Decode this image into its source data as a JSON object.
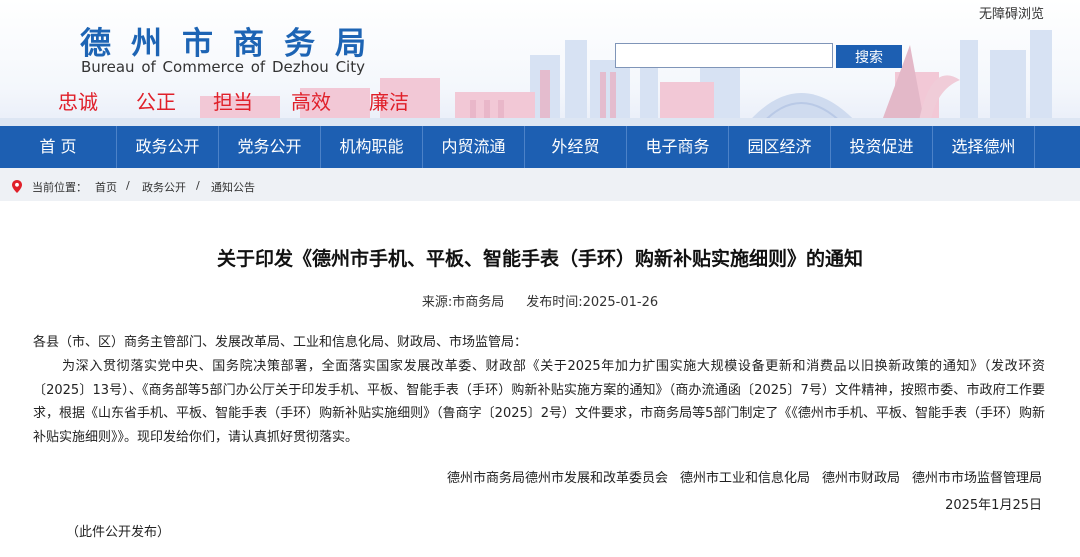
{
  "header": {
    "accessibility_link": "无障碍浏览",
    "site_title_cn": "德州市商务局",
    "site_title_en": "Bureau of Commerce of Dezhou City",
    "values": [
      "忠诚",
      "公正",
      "担当",
      "高效",
      "廉洁"
    ],
    "search": {
      "placeholder": "",
      "button_label": "搜索"
    }
  },
  "nav": {
    "items": [
      "首 页",
      "政务公开",
      "党务公开",
      "机构职能",
      "内贸流通",
      "外经贸",
      "电子商务",
      "园区经济",
      "投资促进",
      "选择德州"
    ]
  },
  "breadcrumb": {
    "label": "当前位置：",
    "items": [
      "首页",
      "政务公开",
      "通知公告"
    ],
    "separator": "/"
  },
  "article": {
    "title": "关于印发《德州市手机、平板、智能手表（手环）购新补贴实施细则》的通知",
    "source": "来源:市商务局",
    "published": "发布时间:2025-01-26",
    "salutation": "各县（市、区）商务主管部门、发展改革局、工业和信息化局、财政局、市场监管局：",
    "paragraph": "为深入贯彻落实党中央、国务院决策部署，全面落实国家发展改革委、财政部《关于2025年加力扩围实施大规模设备更新和消费品以旧换新政策的通知》（发改环资〔2025〕13号）、《商务部等5部门办公厅关于印发手机、平板、智能手表（手环）购新补贴实施方案的通知》（商办流通函〔2025〕7号）文件精神，按照市委、市政府工作要求，根据《山东省手机、平板、智能手表（手环）购新补贴实施细则》（鲁商字〔2025〕2号）文件要求，市商务局等5部门制定了《《德州市手机、平板、智能手表（手环）购新补贴实施细则》》。现印发给你们，请认真抓好贯彻落实。",
    "issuers": [
      "德州市商务局德州市发展和改革委员会",
      "德州市工业和信息化局",
      "德州市财政局",
      "德州市市场监督管理局"
    ],
    "date": "2025年1月25日",
    "note": "（此件公开发布）"
  },
  "colors": {
    "brand_blue": "#1d5fb2",
    "title_blue": "#1d64b4",
    "value_red": "#e0202a",
    "crumb_bg": "#eef1f5"
  }
}
